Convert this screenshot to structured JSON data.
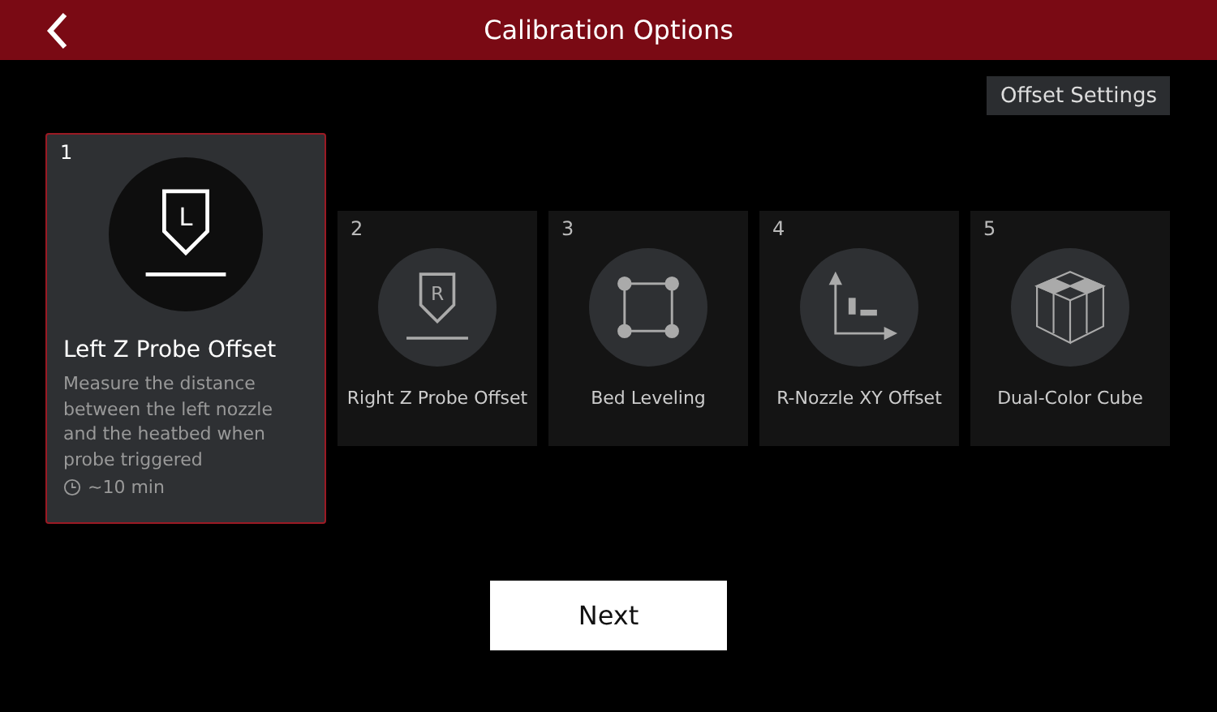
{
  "header": {
    "title": "Calibration Options"
  },
  "offset_button": "Offset Settings",
  "cards": [
    {
      "number": "1",
      "kind": "probe",
      "icon_letter": "L",
      "title": "Left Z Probe Offset",
      "description": "Measure the distance between the left nozzle and the heatbed when probe triggered",
      "duration": "~10 min",
      "selected": true
    },
    {
      "number": "2",
      "kind": "probe",
      "icon_letter": "R",
      "title": "Right Z Probe Offset",
      "selected": false
    },
    {
      "number": "3",
      "kind": "bed",
      "title": "Bed Leveling",
      "selected": false
    },
    {
      "number": "4",
      "kind": "xy",
      "title": "R-Nozzle XY Offset",
      "selected": false
    },
    {
      "number": "5",
      "kind": "cube",
      "title": "Dual-Color Cube",
      "selected": false
    }
  ],
  "next_button": "Next"
}
